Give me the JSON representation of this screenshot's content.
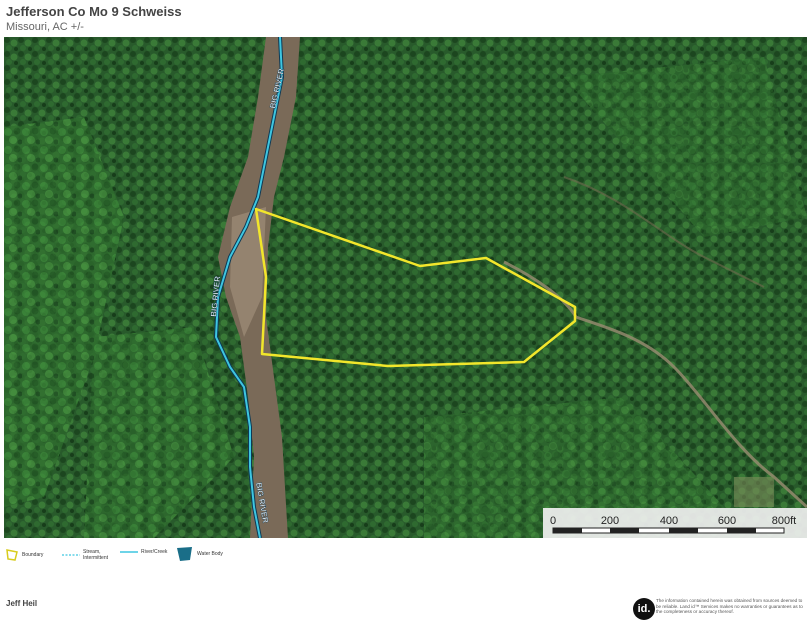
{
  "header": {
    "title": "Jefferson Co Mo 9 Schweiss",
    "subtitle": "Missouri,  AC +/-"
  },
  "map": {
    "river_labels": [
      "BIG RIVER",
      "BIG RIVER",
      "BIG RIVER"
    ],
    "colors": {
      "boundary": "#f2e62b",
      "river": "#3ec6e0",
      "forest": "#26572a",
      "riverbed": "#7a6a5a"
    },
    "scale": {
      "ticks": [
        "0",
        "200",
        "400",
        "600",
        "800ft"
      ]
    }
  },
  "legend": {
    "items": [
      {
        "label": "Boundary",
        "icon": "boundary-icon"
      },
      {
        "label": "Stream, Intermittent",
        "icon": "stream-intermittent-icon"
      },
      {
        "label": "River/Creek",
        "icon": "river-creek-icon"
      },
      {
        "label": "Water Body",
        "icon": "water-body-icon"
      }
    ]
  },
  "footer": {
    "name": "Jeff Heil",
    "logo_text": "id.",
    "disclaimer": "The information contained herein was obtained from sources deemed to be reliable. Land id™ Services makes no warranties or guarantees as to the completeness or accuracy thereof."
  }
}
